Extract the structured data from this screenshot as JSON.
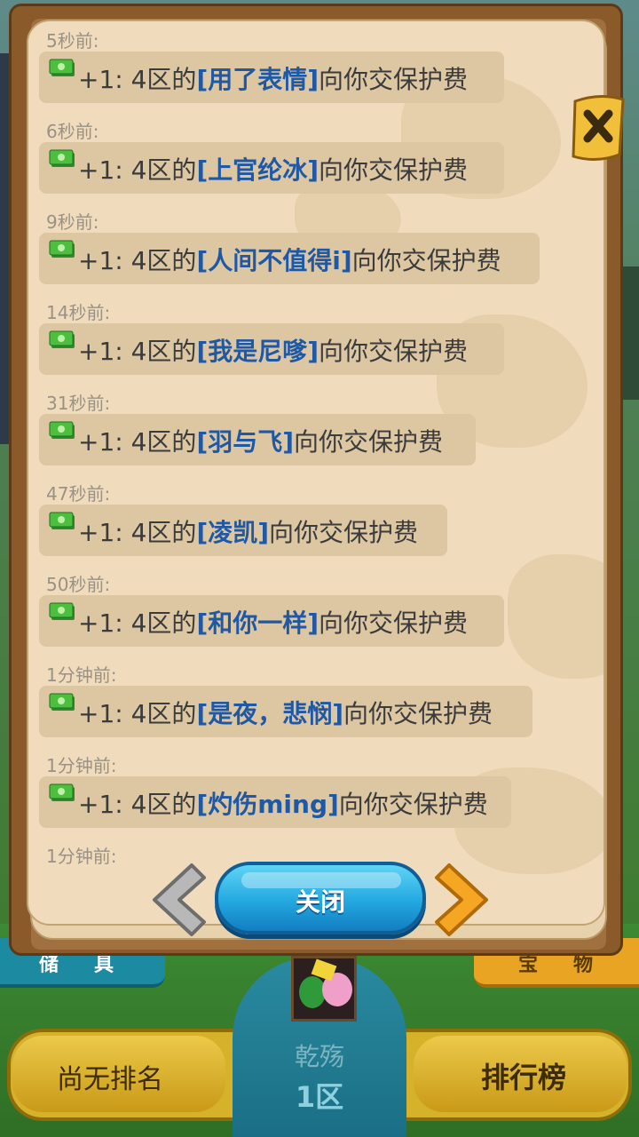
{
  "modal": {
    "close_label": "关闭",
    "entries": [
      {
        "time": "5秒前:",
        "prefix": "+1: 4区的",
        "name": "[用了表情]",
        "suffix": "向你交保护费"
      },
      {
        "time": "6秒前:",
        "prefix": "+1: 4区的",
        "name": "[上官纶冰]",
        "suffix": "向你交保护费"
      },
      {
        "time": "9秒前:",
        "prefix": "+1: 4区的",
        "name": "[人间不值得i]",
        "suffix": "向你交保护费"
      },
      {
        "time": "14秒前:",
        "prefix": "+1: 4区的",
        "name": "[我是尼嗲]",
        "suffix": "向你交保护费"
      },
      {
        "time": "31秒前:",
        "prefix": "+1: 4区的",
        "name": "[羽与飞]",
        "suffix": "向你交保护费"
      },
      {
        "time": "47秒前:",
        "prefix": "+1: 4区的",
        "name": "[凌凯]",
        "suffix": "向你交保护费"
      },
      {
        "time": "50秒前:",
        "prefix": "+1: 4区的",
        "name": "[和你一样]",
        "suffix": "向你交保护费"
      },
      {
        "time": "1分钟前:",
        "prefix": "+1: 4区的",
        "name": "[是夜，悲悯]",
        "suffix": "向你交保护费"
      },
      {
        "time": "1分钟前:",
        "prefix": "+1: 4区的",
        "name": "[灼伤ming]",
        "suffix": "向你交保护费"
      }
    ],
    "trailing_time": "1分钟前:"
  },
  "bottom": {
    "no_rank": "尚无排名",
    "leaderboard": "排行榜",
    "player_name": "乾殇",
    "server": "1区"
  },
  "icons": {
    "entry_icon": "money-icon",
    "close_icon": "close-x-icon",
    "prev": "arrow-left-icon",
    "next": "arrow-right-icon"
  },
  "colors": {
    "name_link": "#1f59a6",
    "page_bg": "#f0dcbd",
    "close_button": "#23a8e0"
  }
}
